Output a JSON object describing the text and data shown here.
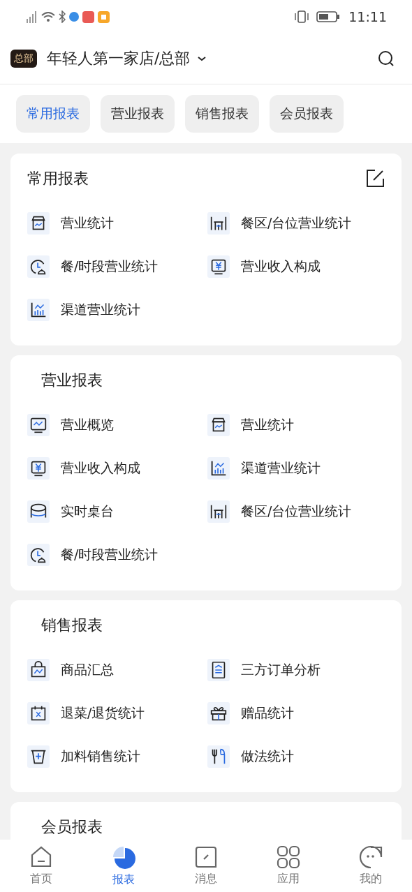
{
  "status_bar": {
    "time": "11:11"
  },
  "header": {
    "badge": "总部",
    "store": "年轻人第一家店/总部"
  },
  "tabs": [
    {
      "label": "常用报表",
      "selected": true
    },
    {
      "label": "营业报表",
      "selected": false
    },
    {
      "label": "销售报表",
      "selected": false
    },
    {
      "label": "会员报表",
      "selected": false
    }
  ],
  "sections": [
    {
      "title": "常用报表",
      "editable": true,
      "items": [
        {
          "label": "营业统计",
          "kind": "store"
        },
        {
          "label": "餐区/台位营业统计",
          "kind": "tables"
        },
        {
          "label": "餐/时段营业统计",
          "kind": "clock"
        },
        {
          "label": "营业收入构成",
          "kind": "yuan"
        },
        {
          "label": "渠道营业统计",
          "kind": "bars"
        }
      ]
    },
    {
      "title": "营业报表",
      "editable": false,
      "items": [
        {
          "label": "营业概览",
          "kind": "monitor"
        },
        {
          "label": "营业统计",
          "kind": "store"
        },
        {
          "label": "营业收入构成",
          "kind": "yuan"
        },
        {
          "label": "渠道营业统计",
          "kind": "bars"
        },
        {
          "label": "实时桌台",
          "kind": "drum"
        },
        {
          "label": "餐区/台位营业统计",
          "kind": "tables"
        },
        {
          "label": "餐/时段营业统计",
          "kind": "clock"
        }
      ]
    },
    {
      "title": "销售报表",
      "editable": false,
      "items": [
        {
          "label": "商品汇总",
          "kind": "bag"
        },
        {
          "label": "三方订单分析",
          "kind": "doc"
        },
        {
          "label": "退菜/退货统计",
          "kind": "calx"
        },
        {
          "label": "赠品统计",
          "kind": "gift"
        },
        {
          "label": "加料销售统计",
          "kind": "cup"
        },
        {
          "label": "做法统计",
          "kind": "fork"
        }
      ]
    },
    {
      "title": "会员报表",
      "editable": false
    }
  ],
  "nav": [
    {
      "label": "首页",
      "kind": "home",
      "selected": false
    },
    {
      "label": "报表",
      "kind": "pie",
      "selected": true
    },
    {
      "label": "消息",
      "kind": "msg",
      "selected": false
    },
    {
      "label": "应用",
      "kind": "apps",
      "selected": false
    },
    {
      "label": "我的",
      "kind": "me",
      "selected": false
    }
  ]
}
